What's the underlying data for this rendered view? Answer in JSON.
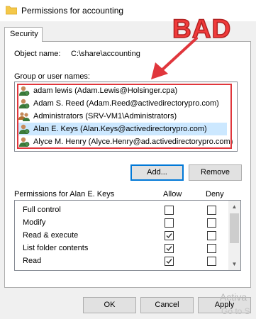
{
  "window": {
    "title": "Permissions for accounting",
    "folder_icon": "folder-icon"
  },
  "tabs": [
    {
      "label": "Security"
    }
  ],
  "object": {
    "label": "Object name:",
    "value": "C:\\share\\accounting"
  },
  "annotation": {
    "text": "BAD",
    "color": "#f03a3a"
  },
  "groups": {
    "label": "Group or user names:",
    "items": [
      {
        "label": "adam lewis (Adam.Lewis@Holsinger.cpa)",
        "icon": "user-icon"
      },
      {
        "label": "Adam S. Reed (Adam.Reed@activedirectorypro.com)",
        "icon": "user-icon"
      },
      {
        "label": "Administrators (SRV-VM1\\Administrators)",
        "icon": "group-icon"
      },
      {
        "label": "Alan E. Keys (Alan.Keys@activedirectorypro.com)",
        "icon": "user-icon",
        "selected": true
      },
      {
        "label": "Alyce M. Henry (Alyce.Henry@ad.activedirectorypro.com)",
        "icon": "user-icon"
      }
    ]
  },
  "buttons": {
    "add": "Add...",
    "remove": "Remove",
    "ok": "OK",
    "cancel": "Cancel",
    "apply": "Apply"
  },
  "permissions": {
    "title": "Permissions for Alan E. Keys",
    "allow_header": "Allow",
    "deny_header": "Deny",
    "rows": [
      {
        "name": "Full control",
        "allow": false,
        "deny": false
      },
      {
        "name": "Modify",
        "allow": false,
        "deny": false
      },
      {
        "name": "Read & execute",
        "allow": true,
        "deny": false
      },
      {
        "name": "List folder contents",
        "allow": true,
        "deny": false
      },
      {
        "name": "Read",
        "allow": true,
        "deny": false
      }
    ]
  },
  "watermark": {
    "line1": "Activa",
    "line2": "Go to S"
  },
  "colors": {
    "selection": "#cce8ff",
    "highlight_border": "#e0363c",
    "accent": "#0078d7"
  }
}
